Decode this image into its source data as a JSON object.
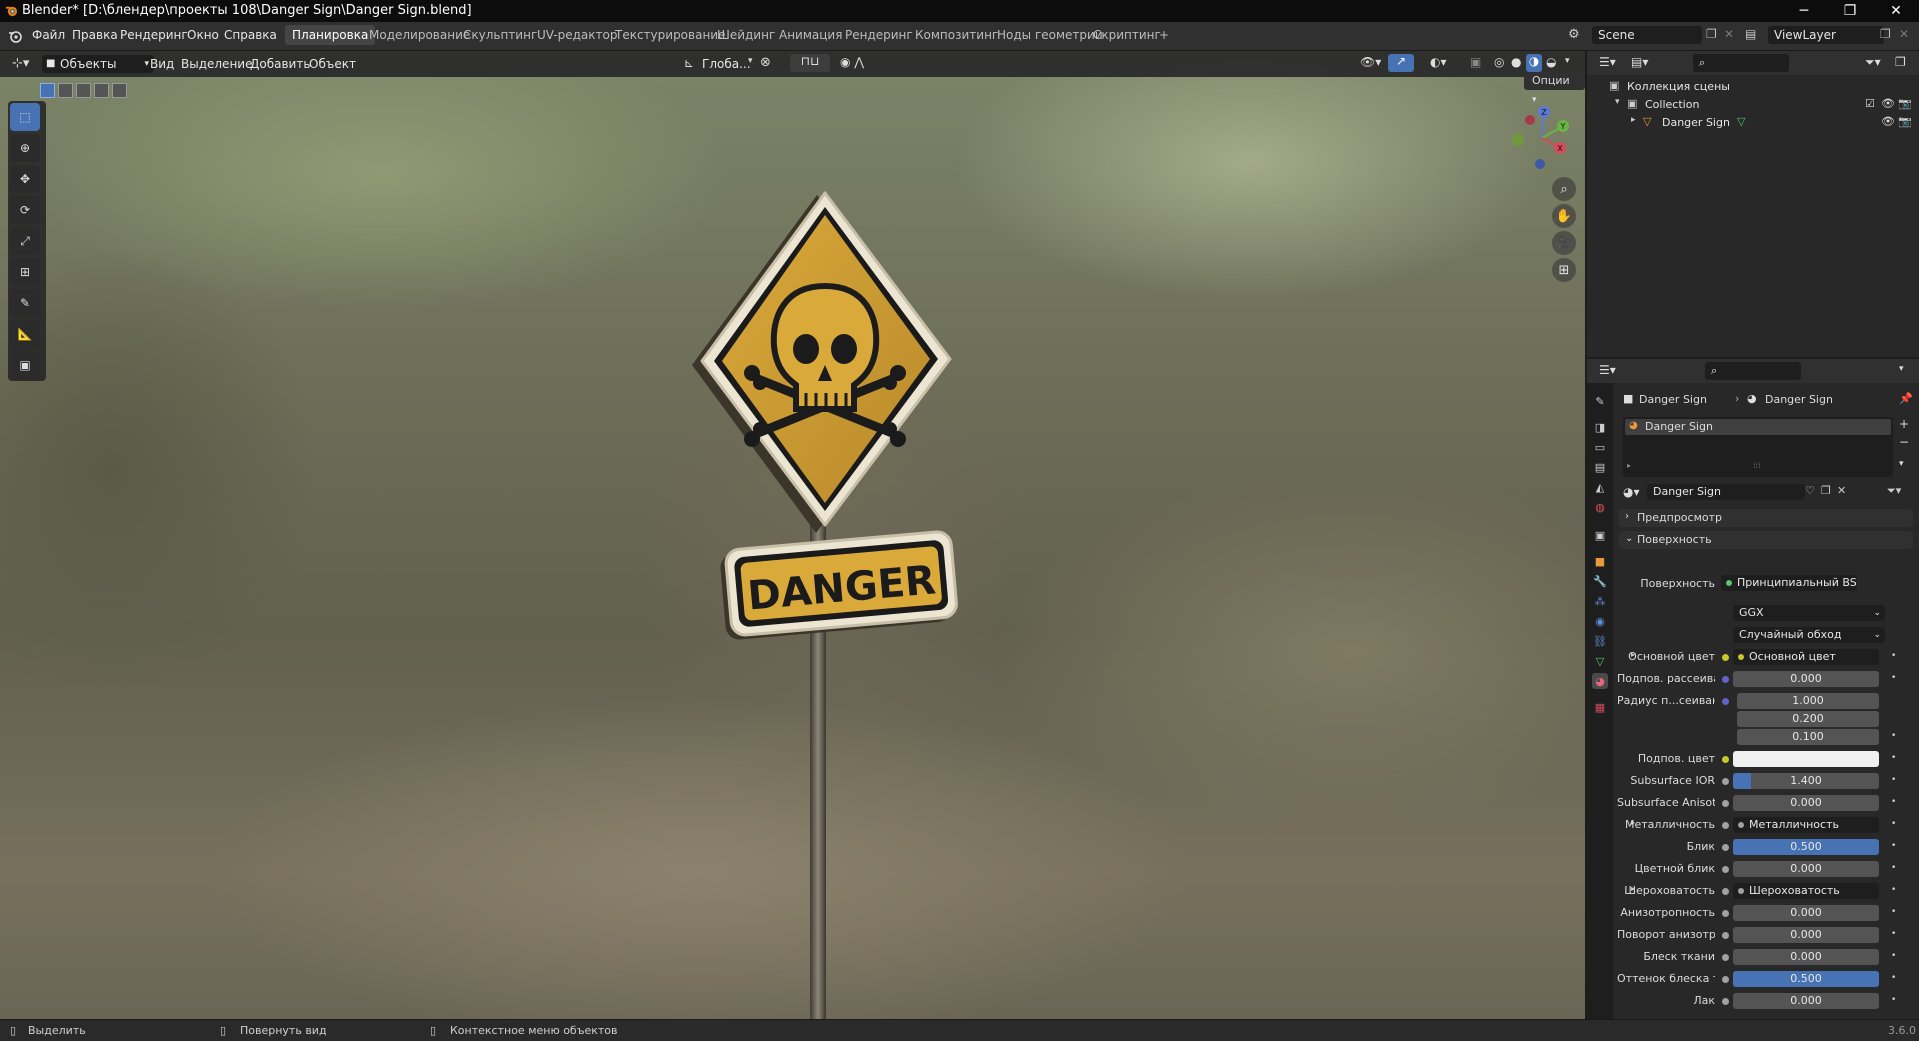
{
  "window": {
    "title": "Blender* [D:\\блендер\\проекты 108\\Danger Sign\\Danger Sign.blend]",
    "minimize": "─",
    "maximize": "❐",
    "close": "✕"
  },
  "menu": {
    "items": [
      "Файл",
      "Правка",
      "Рендеринг",
      "Окно",
      "Справка"
    ]
  },
  "workspaces": {
    "tabs": [
      "Планировка",
      "Моделирование",
      "Скульптинг",
      "UV-редактор",
      "Текстурирование",
      "Шейдинг",
      "Анимация",
      "Рендеринг",
      "Композитинг",
      "Ноды геометрии",
      "Скриптинг"
    ],
    "active_index": 0,
    "add": "+"
  },
  "scene": {
    "name": "Scene",
    "view_layer": "ViewLayer"
  },
  "viewport": {
    "mode": "Объекты",
    "menus": [
      "Вид",
      "Выделение",
      "Добавить",
      "Объект"
    ],
    "orientation": "Глоба...",
    "options": "Опции",
    "gizmo": {
      "z": "Z",
      "y": "Y",
      "x": "X"
    },
    "sign_text": "DANGER"
  },
  "outliner": {
    "root": "Коллекция сцены",
    "collection": "Collection",
    "object": "Danger Sign"
  },
  "properties": {
    "breadcrumb": {
      "object": "Danger Sign",
      "material": "Danger Sign"
    },
    "slot_name": "Danger Sign",
    "material_name": "Danger Sign",
    "panels": {
      "preview": "Предпросмотр",
      "surface": "Поверхность"
    },
    "surface_label": "Поверхность",
    "surface_value": "Принципиальный BSDF",
    "distribution": "GGX",
    "subsurface_method": "Случайный обход",
    "rows": [
      {
        "label": "Основной цвет",
        "type": "link",
        "value": "Основной цвет",
        "expand": true,
        "socket": "#c7c729"
      },
      {
        "label": "Подпов. рассеива...",
        "type": "num",
        "value": "0.000",
        "fill": 0,
        "socket": "#6363c7"
      },
      {
        "label": "Радиус п...сеивания",
        "type": "vec",
        "values": [
          "1.000",
          "0.200",
          "0.100"
        ],
        "socket": "#6363c7"
      },
      {
        "label": "Подпов. цвет",
        "type": "color",
        "value": "#f0f0f0",
        "socket": "#c7c729"
      },
      {
        "label": "Subsurface IOR",
        "type": "num",
        "value": "1.400",
        "fill": 0.12,
        "socket": "#a1a1a1"
      },
      {
        "label": "Subsurface Anisotr...",
        "type": "num",
        "value": "0.000",
        "fill": 0,
        "socket": "#a1a1a1"
      },
      {
        "label": "Металличность",
        "type": "link",
        "value": "Металличность",
        "expand": true,
        "socket": "#a1a1a1"
      },
      {
        "label": "Блик",
        "type": "num",
        "value": "0.500",
        "fill": 1,
        "socket": "#a1a1a1"
      },
      {
        "label": "Цветной блик",
        "type": "num",
        "value": "0.000",
        "fill": 0,
        "socket": "#a1a1a1"
      },
      {
        "label": "Шероховатость",
        "type": "link",
        "value": "Шероховатость",
        "expand": true,
        "socket": "#a1a1a1"
      },
      {
        "label": "Анизотропность",
        "type": "num",
        "value": "0.000",
        "fill": 0,
        "socket": "#a1a1a1"
      },
      {
        "label": "Поворот анизотро...",
        "type": "num",
        "value": "0.000",
        "fill": 0,
        "socket": "#a1a1a1"
      },
      {
        "label": "Блеск ткани",
        "type": "num",
        "value": "0.000",
        "fill": 0,
        "socket": "#a1a1a1"
      },
      {
        "label": "Оттенок блеска тк...",
        "type": "num",
        "value": "0.500",
        "fill": 1,
        "socket": "#a1a1a1"
      },
      {
        "label": "Лак",
        "type": "num",
        "value": "0.000",
        "fill": 0,
        "socket": "#a1a1a1"
      }
    ]
  },
  "statusbar": {
    "select": "Выделить",
    "rotate": "Повернуть вид",
    "context": "Контекстное меню объектов",
    "version": "3.6.0"
  }
}
